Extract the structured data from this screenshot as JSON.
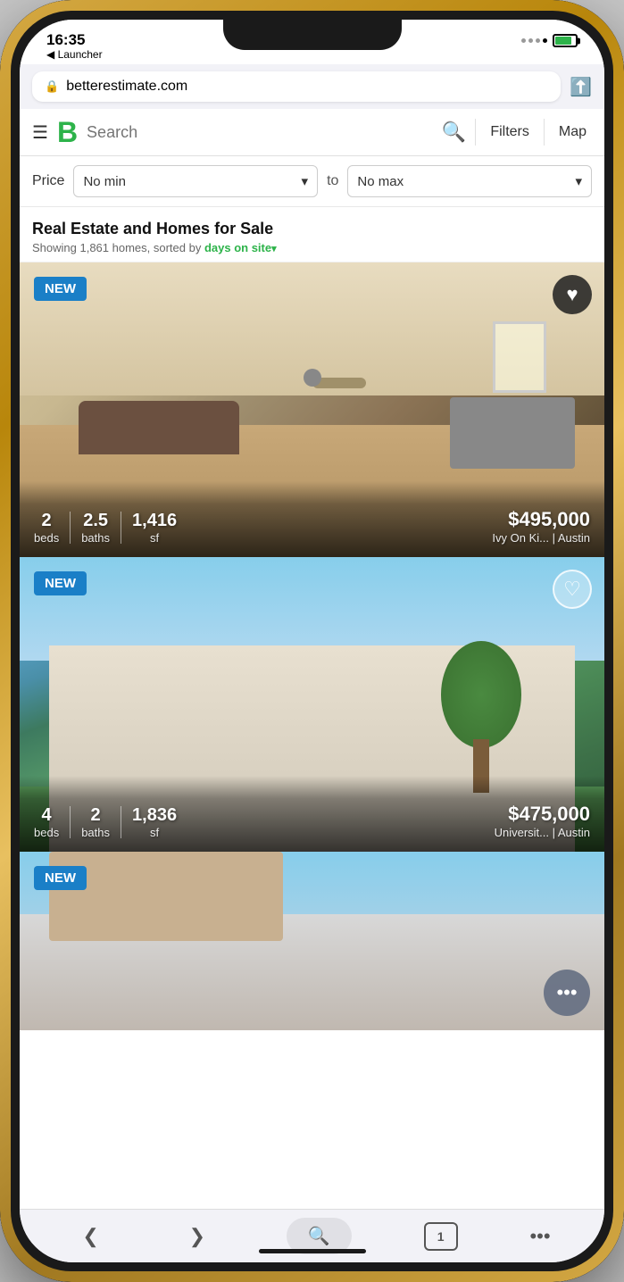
{
  "status_bar": {
    "time": "16:35",
    "carrier": "◀ Launcher",
    "battery_percent": 80
  },
  "browser": {
    "url": "betterestimate.com",
    "share_label": "⬆"
  },
  "header": {
    "menu_label": "☰",
    "brand": "B",
    "search_placeholder": "Search",
    "filters_label": "Filters",
    "map_label": "Map"
  },
  "price_filter": {
    "label": "Price",
    "min_label": "No min",
    "to_label": "to",
    "max_label": "No max"
  },
  "section": {
    "title": "Real Estate and Homes for Sale",
    "subtitle_prefix": "Showing 1,861 homes, sorted by ",
    "sort_label": "days on site",
    "sort_arrow": "▾"
  },
  "listings": [
    {
      "badge": "NEW",
      "beds": "2",
      "baths": "2.5",
      "sqft": "1,416",
      "beds_label": "beds",
      "baths_label": "baths",
      "sqft_label": "sf",
      "price": "$495,000",
      "location": "Ivy On Ki... | Austin",
      "type": "interior"
    },
    {
      "badge": "NEW",
      "beds": "4",
      "baths": "2",
      "sqft": "1,836",
      "beds_label": "beds",
      "baths_label": "baths",
      "sqft_label": "sf",
      "price": "$475,000",
      "location": "Universit... | Austin",
      "type": "exterior"
    },
    {
      "badge": "NEW",
      "type": "partial"
    }
  ],
  "browser_nav": {
    "back_label": "❮",
    "forward_label": "❯",
    "tab_count": "1",
    "more_label": "•••"
  },
  "chat": {
    "icon": "•••"
  }
}
